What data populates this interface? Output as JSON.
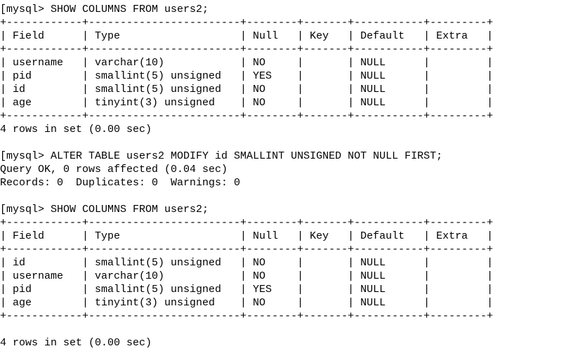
{
  "session": {
    "prompt": "[mysql> ",
    "cmd_show": "SHOW COLUMNS FROM users2;",
    "cmd_alter": "ALTER TABLE users2 MODIFY id SMALLINT UNSIGNED NOT NULL FIRST;",
    "alter_result_line1": "Query OK, 0 rows affected (0.04 sec)",
    "alter_result_line2": "Records: 0  Duplicates: 0  Warnings: 0",
    "rows_summary": "4 rows in set (0.00 sec)"
  },
  "table_header": {
    "field": "Field",
    "type": "Type",
    "null": "Null",
    "key": "Key",
    "default": "Default",
    "extra": "Extra"
  },
  "col_widths": {
    "field": 10,
    "type": 22,
    "null": 6,
    "key": 5,
    "default": 9,
    "extra": 7
  },
  "table1_rows": [
    {
      "field": "username",
      "type": "varchar(10)",
      "null": "NO",
      "key": "",
      "default": "NULL",
      "extra": ""
    },
    {
      "field": "pid",
      "type": "smallint(5) unsigned",
      "null": "YES",
      "key": "",
      "default": "NULL",
      "extra": ""
    },
    {
      "field": "id",
      "type": "smallint(5) unsigned",
      "null": "NO",
      "key": "",
      "default": "NULL",
      "extra": ""
    },
    {
      "field": "age",
      "type": "tinyint(3) unsigned",
      "null": "NO",
      "key": "",
      "default": "NULL",
      "extra": ""
    }
  ],
  "table2_rows": [
    {
      "field": "id",
      "type": "smallint(5) unsigned",
      "null": "NO",
      "key": "",
      "default": "NULL",
      "extra": ""
    },
    {
      "field": "username",
      "type": "varchar(10)",
      "null": "NO",
      "key": "",
      "default": "NULL",
      "extra": ""
    },
    {
      "field": "pid",
      "type": "smallint(5) unsigned",
      "null": "YES",
      "key": "",
      "default": "NULL",
      "extra": ""
    },
    {
      "field": "age",
      "type": "tinyint(3) unsigned",
      "null": "NO",
      "key": "",
      "default": "NULL",
      "extra": ""
    }
  ],
  "chart_data": {
    "type": "table",
    "title": "SHOW COLUMNS FROM users2",
    "columns": [
      "Field",
      "Type",
      "Null",
      "Key",
      "Default",
      "Extra"
    ],
    "before_alter": [
      [
        "username",
        "varchar(10)",
        "NO",
        "",
        "NULL",
        ""
      ],
      [
        "pid",
        "smallint(5) unsigned",
        "YES",
        "",
        "NULL",
        ""
      ],
      [
        "id",
        "smallint(5) unsigned",
        "NO",
        "",
        "NULL",
        ""
      ],
      [
        "age",
        "tinyint(3) unsigned",
        "NO",
        "",
        "NULL",
        ""
      ]
    ],
    "after_alter": [
      [
        "id",
        "smallint(5) unsigned",
        "NO",
        "",
        "NULL",
        ""
      ],
      [
        "username",
        "varchar(10)",
        "NO",
        "",
        "NULL",
        ""
      ],
      [
        "pid",
        "smallint(5) unsigned",
        "YES",
        "",
        "NULL",
        ""
      ],
      [
        "age",
        "tinyint(3) unsigned",
        "NO",
        "",
        "NULL",
        ""
      ]
    ]
  }
}
